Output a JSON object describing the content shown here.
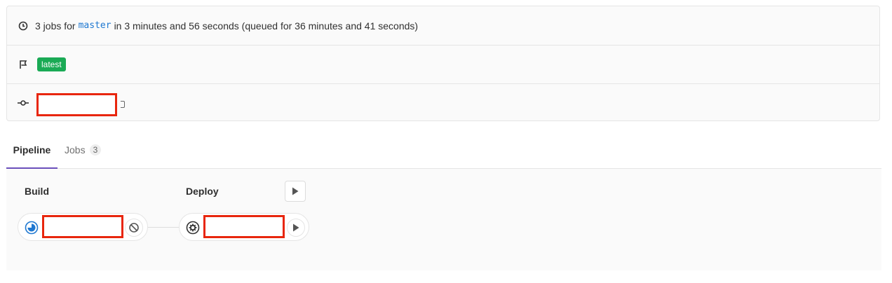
{
  "summary": {
    "jobs_prefix": "3 jobs for",
    "branch": "master",
    "jobs_suffix": "in 3 minutes and 56 seconds (queued for 36 minutes and 41 seconds)",
    "badge": "latest"
  },
  "tabs": [
    {
      "label": "Pipeline",
      "active": true
    },
    {
      "label": "Jobs",
      "count": "3"
    }
  ],
  "stages": [
    {
      "title": "Build"
    },
    {
      "title": "Deploy"
    }
  ],
  "colors": {
    "badge_green": "#1aaa55",
    "link_blue": "#1f78d1",
    "active_tab": "#6b4fbb",
    "running_blue": "#1f78d1",
    "redaction": "#e8260d"
  }
}
